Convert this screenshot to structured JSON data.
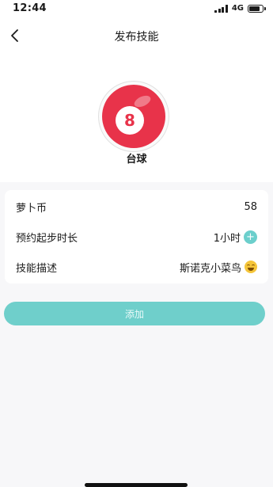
{
  "status_bar": {
    "time": "12:44",
    "network": "4G",
    "battery_level": 0.8
  },
  "header": {
    "back_icon": "chevron-left-icon",
    "title": "发布技能"
  },
  "skill": {
    "ball_number": "8",
    "name": "台球"
  },
  "info_rows": [
    {
      "label": "萝卜币",
      "value": "58"
    },
    {
      "label": "预约起步时长",
      "value": "1小时",
      "action_icon": "plus-icon"
    },
    {
      "label": "技能描述",
      "value": "斯诺克小菜鸟",
      "trailing_icon": "laughing-crying-emoji-icon"
    }
  ],
  "add_button": {
    "label": "添加"
  },
  "colors": {
    "accent": "#6fcfcb",
    "ball_red": "#e8334a",
    "background": "#f7f7f9"
  }
}
